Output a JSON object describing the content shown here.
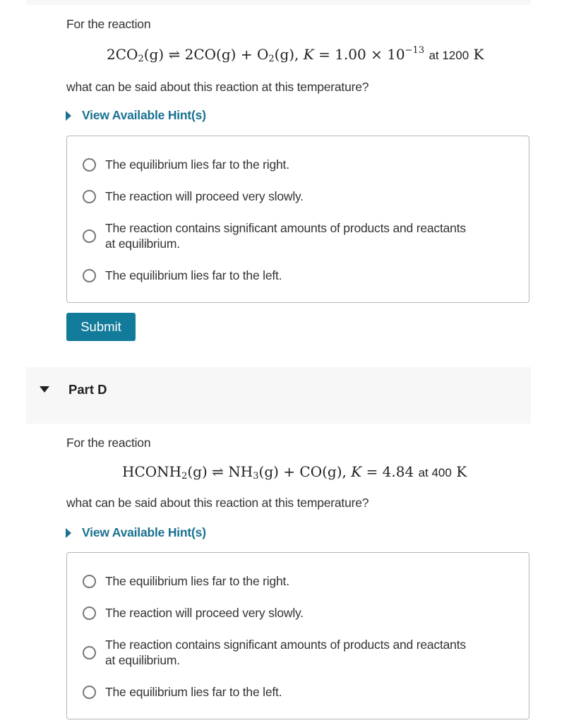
{
  "part_c": {
    "intro": "For the reaction",
    "equation": {
      "reactant": "2CO",
      "reactant_sub": "2",
      "state": "(g)",
      "arrow": "⇌",
      "product1": "2CO(g)",
      "plus": "+",
      "product2": "O",
      "product2_sub": "2",
      "product2_state": "(g),",
      "k_symbol": "K",
      "k_equals": "= 1.00 × 10",
      "k_exp": "−13",
      "at_text": "at 1200",
      "unit": "K"
    },
    "question": "what can be said about this reaction at this temperature?",
    "hint_label": "View Available Hint(s)",
    "choices": [
      {
        "label": "The equilibrium lies far to the right.",
        "selected": false
      },
      {
        "label": "The reaction will proceed very slowly.",
        "selected": false
      },
      {
        "label": "The reaction contains significant amounts of products and reactants",
        "label_line2": "at equilibrium.",
        "selected": false
      },
      {
        "label": "The equilibrium lies far to the left.",
        "selected": false
      }
    ],
    "submit_label": "Submit"
  },
  "part_d": {
    "title": "Part D",
    "intro": "For the reaction",
    "equation": {
      "reactant": "HCONH",
      "reactant_sub": "2",
      "state": "(g)",
      "arrow": "⇌",
      "product1": "NH",
      "product1_sub": "3",
      "product1_state": "(g)",
      "plus": "+",
      "product2": "CO(g),",
      "k_symbol": "K",
      "k_equals": "= 4.84",
      "at_text": "at 400",
      "unit": "K"
    },
    "question": "what can be said about this reaction at this temperature?",
    "hint_label": "View Available Hint(s)",
    "choices": [
      {
        "label": "The equilibrium lies far to the right.",
        "selected": false
      },
      {
        "label": "The reaction will proceed very slowly.",
        "selected": false
      },
      {
        "label": "The reaction contains significant amounts of products and reactants",
        "label_line2": "at equilibrium.",
        "selected": false
      },
      {
        "label": "The equilibrium lies far to the left.",
        "selected": false
      }
    ]
  },
  "colors": {
    "accent": "#137b9a",
    "hint_link": "#1a7190",
    "panel_bg": "#f7f7f7",
    "border": "#b5b5b5"
  }
}
